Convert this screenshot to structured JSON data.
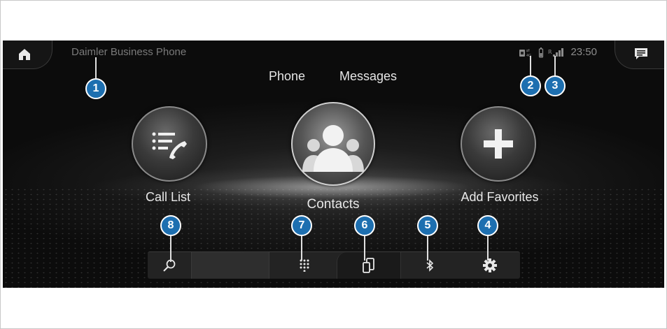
{
  "app": {
    "title": "Daimler Business Phone"
  },
  "status": {
    "time": "23:50",
    "icons": [
      "sim-card-icon",
      "battery-icon",
      "signal-strength-icon"
    ]
  },
  "tabs": [
    {
      "label": "Phone"
    },
    {
      "label": "Messages"
    }
  ],
  "main": {
    "call_list": {
      "label": "Call List",
      "icon": "call-list-icon"
    },
    "contacts": {
      "label": "Contacts",
      "icon": "contacts-icon"
    },
    "favorites": {
      "label": "Add Favorites",
      "icon": "plus-icon"
    }
  },
  "toolbar": {
    "items": [
      {
        "icon": "search-icon"
      },
      {
        "icon": "search-field"
      },
      {
        "icon": "keypad-icon"
      },
      {
        "icon": "devices-icon"
      },
      {
        "icon": "bluetooth-icon"
      },
      {
        "icon": "settings-gear-icon"
      }
    ]
  },
  "callouts": [
    "1",
    "2",
    "3",
    "4",
    "5",
    "6",
    "7",
    "8"
  ],
  "colors": {
    "callout": "#1d6fb0",
    "background": "#0c0c0c",
    "text": "#e8e8e8",
    "title": "#7a7a7a"
  }
}
